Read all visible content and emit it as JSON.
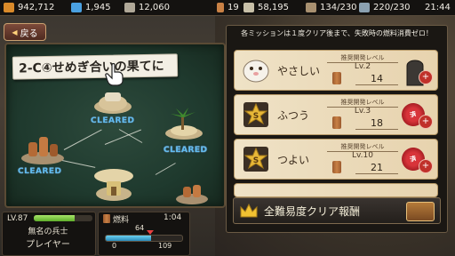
{
  "status_bar": {
    "resources": [
      {
        "name": "coins",
        "value": "942,712",
        "color": "#d98a2a"
      },
      {
        "name": "gems",
        "value": "1,945",
        "color": "#4aa0e0"
      },
      {
        "name": "supplies",
        "value": "12,060",
        "color": "#b0a898"
      },
      {
        "name": "fuel",
        "value": "19",
        "color": "#c98145"
      },
      {
        "name": "medals",
        "value": "58,195",
        "color": "#c8c0a8"
      },
      {
        "name": "units",
        "value": "134/230",
        "color": "#a89070"
      },
      {
        "name": "parts",
        "value": "220/230",
        "color": "#8aa0b0"
      }
    ],
    "clock": "21:44"
  },
  "back_button": {
    "label": "戻る",
    "icon": "triangle-left-icon"
  },
  "map": {
    "title": "2-C④せめぎ合いの果てに",
    "nodes": [
      {
        "label": "CLEARED",
        "icon": "hamburger-island-icon"
      },
      {
        "label": "CLEARED",
        "icon": "palm-island-icon"
      },
      {
        "label": "CLEARED",
        "icon": "rock-island-icon"
      },
      {
        "label": "CLEARED",
        "icon": "house-island-icon"
      },
      {
        "label": "",
        "icon": "sand-island-icon"
      },
      {
        "label": "",
        "icon": "rock-island-icon"
      }
    ],
    "pointer_icon": "pointing-hand-icon"
  },
  "missions": {
    "header": "各ミッションは１度クリア後まで、失敗時の燃料消費ゼロ！",
    "level_header": "推奨開発レベル",
    "cards": [
      {
        "difficulty": "やさしい",
        "level": "Lv.2",
        "fuel_cost": "14",
        "emblem": "hamster-icon",
        "stamp": "",
        "side_icon": "tombstone-icon"
      },
      {
        "difficulty": "ふつう",
        "level": "Lv.3",
        "fuel_cost": "18",
        "emblem": "gold-star-s-icon",
        "stamp": "済",
        "side_icon": "stamp-icon"
      },
      {
        "difficulty": "つよい",
        "level": "Lv.10",
        "fuel_cost": "21",
        "emblem": "gold-star-s-icon",
        "stamp": "済",
        "side_icon": "stamp-icon"
      }
    ]
  },
  "reward_bar": {
    "label": "全難易度クリア報酬",
    "crown_icon": "crown-icon",
    "chest_icon": "treasure-chest-icon"
  },
  "player": {
    "level_label": "LV.87",
    "title": "無名の兵士",
    "name": "プレイヤー",
    "exp_fraction": 0.7
  },
  "fuel_panel": {
    "label": "燃料",
    "timer": "1:04",
    "current": "64",
    "min": "0",
    "max": "109",
    "fill_fraction": 0.59
  }
}
